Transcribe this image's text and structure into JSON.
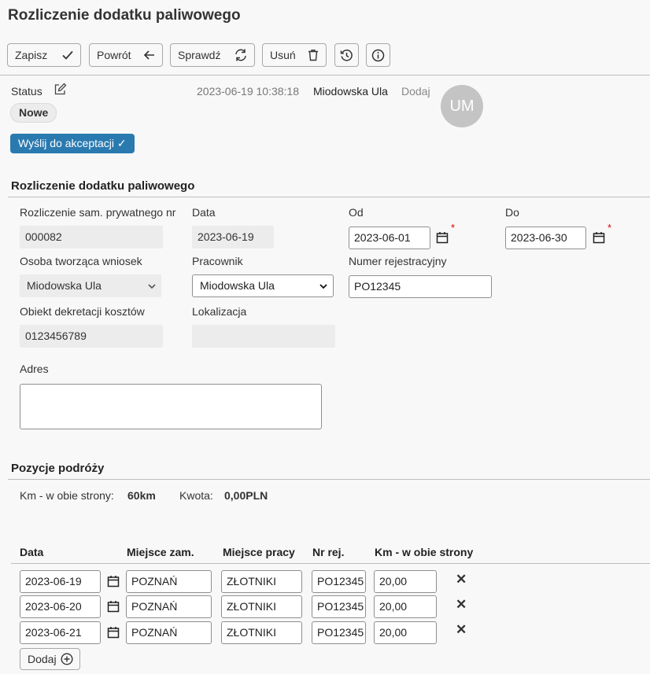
{
  "page_title": "Rozliczenie dodatku paliwowego",
  "toolbar": {
    "save": "Zapisz",
    "back": "Powrót",
    "check": "Sprawdź",
    "delete": "Usuń"
  },
  "status": {
    "label": "Status",
    "value": "Nowe",
    "timestamp": "2023-06-19 10:38:18",
    "user": "Miodowska Ula",
    "add": "Dodaj",
    "avatar_initials": "UM",
    "send_button": "Wyślij do akceptacji ✓"
  },
  "form": {
    "section_title": "Rozliczenie dodatku paliwowego",
    "settlement_no_label": "Rozliczenie sam. prywatnego nr",
    "settlement_no": "000082",
    "date_label": "Data",
    "date": "2023-06-19",
    "from_label": "Od",
    "from": "2023-06-01",
    "to_label": "Do",
    "to": "2023-06-30",
    "creator_label": "Osoba tworząca wniosek",
    "creator": "Miodowska Ula",
    "employee_label": "Pracownik",
    "employee": "Miodowska Ula",
    "reg_no_label": "Numer rejestracyjny",
    "reg_no": "PO12345",
    "cost_object_label": "Obiekt dekretacji kosztów",
    "cost_object": "0123456789",
    "location_label": "Lokalizacja",
    "location": "",
    "address_label": "Adres",
    "address": ""
  },
  "trips": {
    "section_title": "Pozycje podróży",
    "km_label": "Km - w obie strony:",
    "km_value": "60km",
    "amount_label": "Kwota:",
    "amount_value": "0,00PLN",
    "columns": [
      "Data",
      "Miejsce zam.",
      "Miejsce pracy",
      "Nr rej.",
      "Km - w obie strony"
    ],
    "rows": [
      {
        "date": "2023-06-19",
        "home": "POZNAŃ",
        "work": "ZŁOTNIKI",
        "reg": "PO12345",
        "km": "20,00"
      },
      {
        "date": "2023-06-20",
        "home": "POZNAŃ",
        "work": "ZŁOTNIKI",
        "reg": "PO12345",
        "km": "20,00"
      },
      {
        "date": "2023-06-21",
        "home": "POZNAŃ",
        "work": "ZŁOTNIKI",
        "reg": "PO12345",
        "km": "20,00"
      }
    ],
    "add_button": "Dodaj"
  },
  "colors": {
    "accent": "#2a7ab0",
    "required": "#dd0000"
  }
}
